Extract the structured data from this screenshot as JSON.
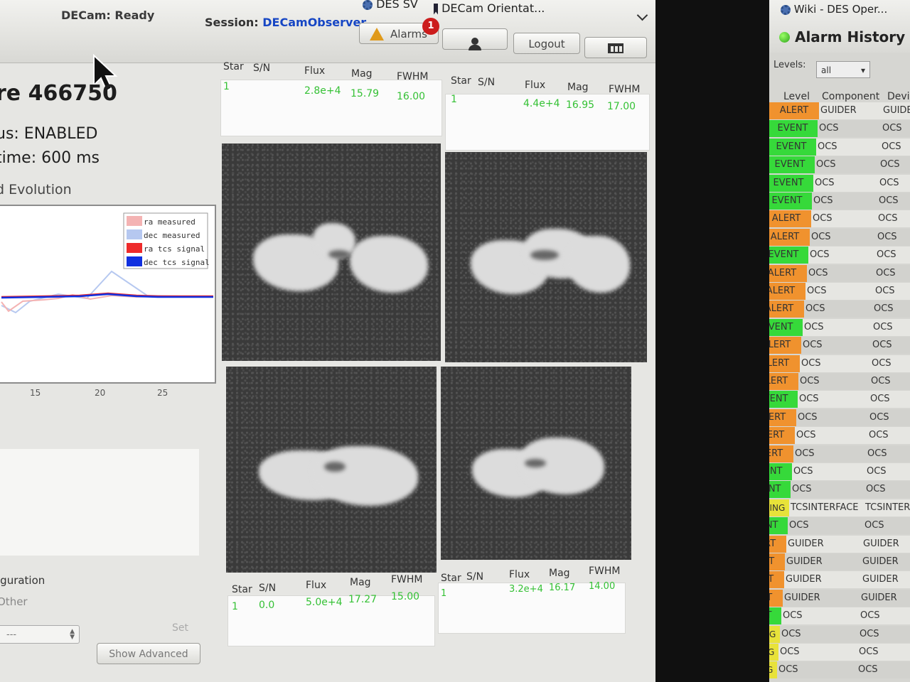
{
  "browser_tabs": [
    "DES SV",
    "DECam Orientat..."
  ],
  "status": {
    "decam": "DECam: Ready",
    "session_label": "Session:",
    "session_value": "DECamObserver"
  },
  "buttons": {
    "alarms": "Alarms",
    "alarms_count": "1",
    "logout": "Logout"
  },
  "panel": {
    "exposure": "re 466750",
    "status_line": "us: ENABLED",
    "exptime": "time: 600 ms",
    "evolution": "d Evolution",
    "configuration": "iguration",
    "other": "Other",
    "select_value": "---",
    "set": "Set",
    "show_advanced": "Show Advanced"
  },
  "chart_data": {
    "type": "line",
    "x_ticks": [
      "15",
      "20",
      "25"
    ],
    "legend": [
      "ra measured",
      "dec measured",
      "ra tcs signal",
      "dec tcs signal"
    ],
    "colors": [
      "#f4b3b3",
      "#b6c8f0",
      "#ee2a2a",
      "#1030e0"
    ]
  },
  "star_headers": [
    "Star",
    "S/N",
    "Flux",
    "Mag",
    "FWHM"
  ],
  "star_tables": [
    {
      "star": "1",
      "sn": "",
      "flux": "2.8e+4",
      "mag": "15.79",
      "fwhm": "16.00"
    },
    {
      "star": "1",
      "sn": "",
      "flux": "4.4e+4",
      "mag": "16.95",
      "fwhm": "17.00"
    },
    {
      "star": "1",
      "sn": "0.0",
      "flux": "5.0e+4",
      "mag": "17.27",
      "fwhm": "15.00"
    },
    {
      "star": "1",
      "sn": "",
      "flux": "3.2e+4",
      "mag": "16.17",
      "fwhm": "14.00"
    }
  ],
  "alarm_history": {
    "tab": "Wiki - DES Oper...",
    "title": "Alarm History",
    "levels_label": "Levels:",
    "levels_value": "all",
    "columns": [
      "Level",
      "Component",
      "Devic"
    ],
    "level_colors": {
      "ALERT": "#f0922e",
      "EVENT": "#36d93a",
      "WARNING": "#e8e23a"
    },
    "rows": [
      {
        "level": "ALERT",
        "component": "GUIDER",
        "device": "GUIDE"
      },
      {
        "level": "EVENT",
        "component": "OCS",
        "device": "OCS"
      },
      {
        "level": "EVENT",
        "component": "OCS",
        "device": "OCS"
      },
      {
        "level": "EVENT",
        "component": "OCS",
        "device": "OCS"
      },
      {
        "level": "EVENT",
        "component": "OCS",
        "device": "OCS"
      },
      {
        "level": "EVENT",
        "component": "OCS",
        "device": "OCS"
      },
      {
        "level": "ALERT",
        "component": "OCS",
        "device": "OCS"
      },
      {
        "level": "ALERT",
        "component": "OCS",
        "device": "OCS"
      },
      {
        "level": "EVENT",
        "component": "OCS",
        "device": "OCS"
      },
      {
        "level": "ALERT",
        "component": "OCS",
        "device": "OCS"
      },
      {
        "level": "ALERT",
        "component": "OCS",
        "device": "OCS"
      },
      {
        "level": "ALERT",
        "component": "OCS",
        "device": "OCS"
      },
      {
        "level": "EVENT",
        "component": "OCS",
        "device": "OCS"
      },
      {
        "level": "ALERT",
        "component": "OCS",
        "device": "OCS"
      },
      {
        "level": "ALERT",
        "component": "OCS",
        "device": "OCS"
      },
      {
        "level": "ALERT",
        "component": "OCS",
        "device": "OCS"
      },
      {
        "level": "EVENT",
        "component": "OCS",
        "device": "OCS"
      },
      {
        "level": "ALERT",
        "component": "OCS",
        "device": "OCS"
      },
      {
        "level": "ALERT",
        "component": "OCS",
        "device": "OCS"
      },
      {
        "level": "ALERT",
        "component": "OCS",
        "device": "OCS"
      },
      {
        "level": "EVENT",
        "component": "OCS",
        "device": "OCS"
      },
      {
        "level": "EVENT",
        "component": "OCS",
        "device": "OCS"
      },
      {
        "level": "WARNING",
        "component": "TCSINTERFACE",
        "device": "TCSINTERFACE"
      },
      {
        "level": "EVENT",
        "component": "OCS",
        "device": "OCS"
      },
      {
        "level": "ALERT",
        "component": "GUIDER",
        "device": "GUIDER"
      },
      {
        "level": "ALERT",
        "component": "GUIDER",
        "device": "GUIDER"
      },
      {
        "level": "ALERT",
        "component": "GUIDER",
        "device": "GUIDER"
      },
      {
        "level": "ALERT",
        "component": "GUIDER",
        "device": "GUIDER"
      },
      {
        "level": "EVENT",
        "component": "OCS",
        "device": "OCS"
      },
      {
        "level": "WARNING",
        "component": "OCS",
        "device": "OCS"
      },
      {
        "level": "WARNING",
        "component": "OCS",
        "device": "OCS"
      },
      {
        "level": "WARNING",
        "component": "OCS",
        "device": "OCS"
      }
    ]
  }
}
